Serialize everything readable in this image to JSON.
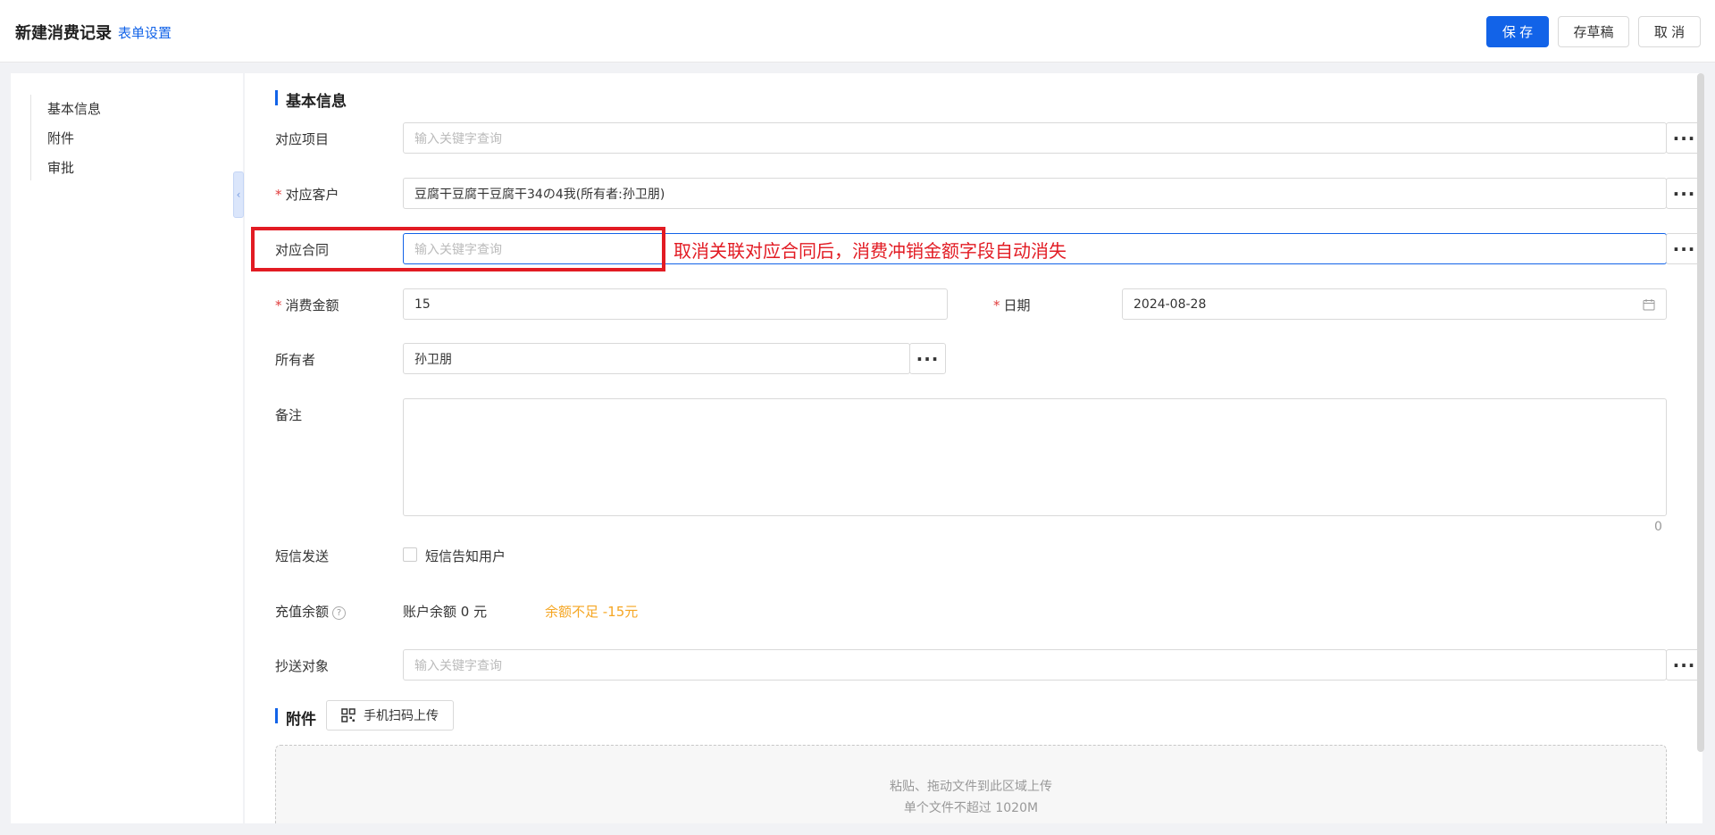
{
  "header": {
    "title": "新建消费记录",
    "form_settings": "表单设置",
    "save": "保 存",
    "draft": "存草稿",
    "cancel": "取 消"
  },
  "sidebar": {
    "items": [
      {
        "label": "基本信息"
      },
      {
        "label": "附件"
      },
      {
        "label": "审批"
      }
    ],
    "collapse_icon": "‹"
  },
  "basic_info": {
    "section_title": "基本信息",
    "project": {
      "label": "对应项目",
      "placeholder": "输入关键字查询",
      "value": ""
    },
    "customer": {
      "label": "对应客户",
      "value": "豆腐干豆腐干豆腐干34の4我(所有者:孙卫朋)"
    },
    "contract": {
      "label": "对应合同",
      "placeholder": "输入关键字查询",
      "value": ""
    },
    "amount": {
      "label": "消费金额",
      "value": "15"
    },
    "date": {
      "label": "日期",
      "value": "2024-08-28"
    },
    "owner": {
      "label": "所有者",
      "value": "孙卫朋"
    },
    "remark": {
      "label": "备注",
      "value": "",
      "count": "0"
    },
    "sms": {
      "label": "短信发送",
      "option": "短信告知用户",
      "checked": false
    },
    "recharge": {
      "label": "充值余额",
      "help": "?",
      "balance": "账户余额 0 元",
      "warning": "余额不足 -15元",
      "warning_color": "#f5a623"
    },
    "cc": {
      "label": "抄送对象",
      "placeholder": "输入关键字查询",
      "value": ""
    },
    "required_mark": "*",
    "dots": "···"
  },
  "attachments": {
    "section_title": "附件",
    "scan_upload": "手机扫码上传",
    "drop_line1": "粘贴、拖动文件到此区域上传",
    "drop_line2": "单个文件不超过 1020M"
  },
  "annotation": {
    "text": "取消关联对应合同后，消费冲销金额字段自动消失",
    "color": "#e21b23"
  },
  "colors": {
    "primary": "#1263e8",
    "required": "#e03c3c"
  }
}
